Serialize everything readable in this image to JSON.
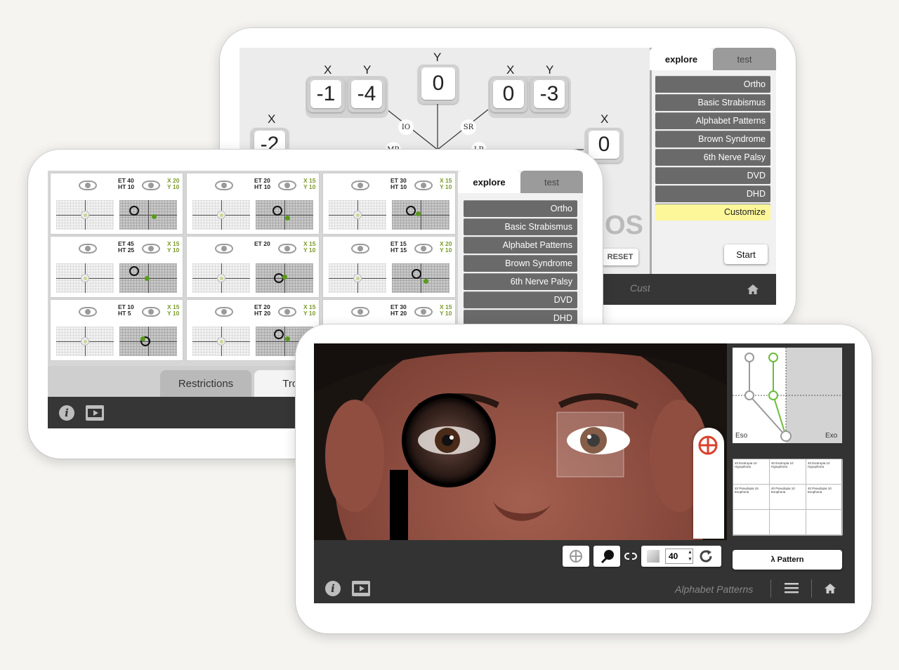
{
  "tablet_top": {
    "axis_labels": {
      "x1": "X",
      "y1": "Y",
      "y_center": "Y",
      "x2": "X",
      "y2": "Y",
      "x_left": "X",
      "x_right": "X"
    },
    "values": {
      "left_x": "-1",
      "left_y": "-4",
      "center": "0",
      "right_x": "0",
      "right_y": "-3",
      "far_left": "-2",
      "far_right": "0"
    },
    "muscles": {
      "io": "IO",
      "sr": "SR",
      "mr": "MR",
      "lr": "LR"
    },
    "partial_title": "OS",
    "reset_label": "RESET",
    "tabs": {
      "explore": "explore",
      "test": "test"
    },
    "menu": [
      "Ortho",
      "Basic Strabismus",
      "Alphabet Patterns",
      "Brown Syndrome",
      "6th Nerve Palsy",
      "DVD",
      "DHD",
      "Customize"
    ],
    "selected": "Customize",
    "start_label": "Start",
    "footer_title": "Customize"
  },
  "tablet_mid": {
    "cells": [
      {
        "l1": "ET 40",
        "l2": "HT 10",
        "g1": "X 20",
        "g2": "Y 10"
      },
      {
        "l1": "ET 20",
        "l2": "HT 10",
        "g1": "X 15",
        "g2": "Y 10"
      },
      {
        "l1": "ET 30",
        "l2": "HT 10",
        "g1": "X 15",
        "g2": "Y 10"
      },
      {
        "l1": "ET 45",
        "l2": "HT 25",
        "g1": "X 15",
        "g2": "Y 10"
      },
      {
        "l1": "ET 20",
        "l2": "",
        "g1": "X 15",
        "g2": "Y 10"
      },
      {
        "l1": "ET 15",
        "l2": "HT 15",
        "g1": "X 20",
        "g2": "Y 10"
      },
      {
        "l1": "ET 10",
        "l2": "HT 5",
        "g1": "X 15",
        "g2": "Y 10"
      },
      {
        "l1": "ET 20",
        "l2": "HT 20",
        "g1": "X 15",
        "g2": "Y 10"
      },
      {
        "l1": "ET 30",
        "l2": "HT 20",
        "g1": "X 15",
        "g2": "Y 10"
      }
    ],
    "tabs": {
      "explore": "explore",
      "test": "test"
    },
    "menu": [
      "Ortho",
      "Basic Strabismus",
      "Alphabet Patterns",
      "Brown Syndrome",
      "6th Nerve Palsy",
      "DVD",
      "DHD"
    ],
    "subtabs": {
      "restrictions": "Restrictions",
      "tropias": "Tropias"
    }
  },
  "tablet_front": {
    "prism_value": "40",
    "graph_labels": {
      "eso": "Eso",
      "exo": "Exo"
    },
    "pattern_cells": [
      "40 Esotropia 10 Hypophoria",
      "40 Esotropia 10 Hypophoria",
      "40 Esotropia 10 Hypophoria",
      "40 Pseudopia 15 Esophoria",
      "40 Pseudopia 10 Esophoria",
      "40 Pseudopia 10 Esophoria"
    ],
    "pattern_button": "λ Pattern",
    "footer_title": "Alphabet Patterns"
  },
  "colors": {
    "accent_green": "#5a9a1a",
    "highlight": "#fdf79a",
    "dark_bar": "#363636",
    "red_target": "#d9412b"
  }
}
